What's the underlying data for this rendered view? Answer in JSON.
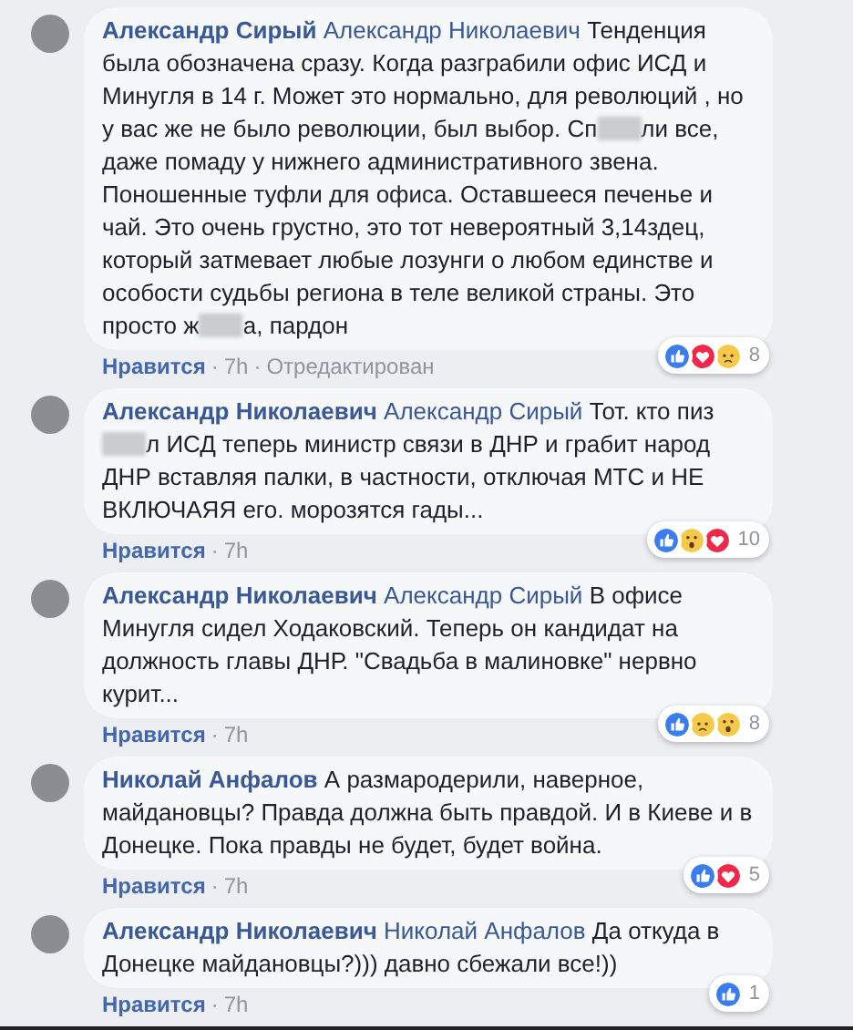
{
  "comments": [
    {
      "author": "Александр Сирый",
      "mention": "Александр Николаевич",
      "body": [
        {
          "kind": "text",
          "text": "Тенденция была обозначена сразу. Когда разграбили офис ИСД и Минугля в 14 г. Может это нормально, для революций , но у вас же не было революции, был выбор. Сп"
        },
        {
          "kind": "blur"
        },
        {
          "kind": "text",
          "text": "ли все, даже помаду у нижнего административного звена. Поношенные туфли для офиса. Оставшееся печенье и чай. Это очень грустно, это тот невероятный 3,14здец, который затмевает любые лозунги о любом единстве и особости судьбы региона в теле великой страны. Это просто ж"
        },
        {
          "kind": "blur"
        },
        {
          "kind": "text",
          "text": "а, пардон"
        }
      ],
      "like": "Нравится",
      "separators": [
        "·",
        "·"
      ],
      "time": "7h",
      "edited": "Отредактирован",
      "reactions": [
        {
          "kind": "like"
        },
        {
          "kind": "love"
        },
        {
          "kind": "sad"
        }
      ],
      "count": "8"
    },
    {
      "author": "Александр Николаевич",
      "mention": "Александр Сирый",
      "body": [
        {
          "kind": "text",
          "text": "Тот. кто пиз"
        },
        {
          "kind": "blur"
        },
        {
          "kind": "text",
          "text": "л ИСД теперь министр связи в ДНР и грабит народ ДНР вставляя палки, в частности, отключая МТС и НЕ ВКЛЮЧАЯЯ его. морозятся гады..."
        }
      ],
      "like": "Нравится",
      "separators": [
        "·"
      ],
      "time": "7h",
      "reactions": [
        {
          "kind": "like"
        },
        {
          "kind": "wow"
        },
        {
          "kind": "love"
        }
      ],
      "count": "10"
    },
    {
      "author": "Александр Николаевич",
      "mention": "Александр Сирый",
      "body": [
        {
          "kind": "text",
          "text": "В офисе Минугля сидел Ходаковский. Теперь он кандидат на должность главы ДНР. \"Свадьба в малиновке\" нервно курит..."
        }
      ],
      "like": "Нравится",
      "separators": [
        "·"
      ],
      "time": "7h",
      "reactions": [
        {
          "kind": "like"
        },
        {
          "kind": "sad"
        },
        {
          "kind": "wow"
        }
      ],
      "count": "8"
    },
    {
      "author": "Николай Анфалов",
      "body": [
        {
          "kind": "text",
          "text": "А размародерили, наверное, майдановцы? Правда должна быть правдой. И в Киеве и в Донецке. Пока правды не будет, будет война."
        }
      ],
      "like": "Нравится",
      "separators": [
        "·"
      ],
      "time": "7h",
      "reactions": [
        {
          "kind": "like"
        },
        {
          "kind": "love"
        }
      ],
      "count": "5"
    },
    {
      "author": "Александр Николаевич",
      "mention": "Николай Анфалов",
      "body": [
        {
          "kind": "text",
          "text": "Да откуда в Донецке майдановцы?))) давно сбежали все!))"
        }
      ],
      "like": "Нравится",
      "separators": [
        "·"
      ],
      "time": "7h",
      "reactions": [
        {
          "kind": "like"
        }
      ],
      "count": "1"
    }
  ]
}
